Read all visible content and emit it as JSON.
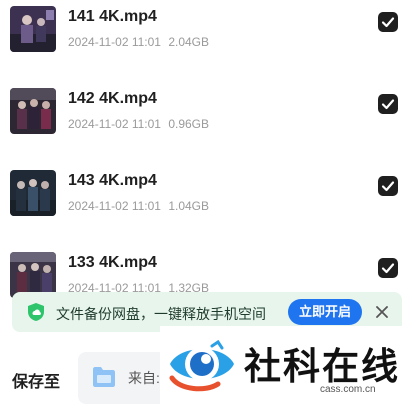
{
  "files": [
    {
      "name": "141 4K.mp4",
      "date": "2024-11-02 11:01",
      "size": "2.04GB",
      "checked": true
    },
    {
      "name": "142 4K.mp4",
      "date": "2024-11-02 11:01",
      "size": "0.96GB",
      "checked": true
    },
    {
      "name": "143 4K.mp4",
      "date": "2024-11-02 11:01",
      "size": "1.04GB",
      "checked": true
    },
    {
      "name": "133 4K.mp4",
      "date": "2024-11-02 11:01",
      "size": "1.32GB",
      "checked": true
    }
  ],
  "banner": {
    "text": "文件备份网盘，一键释放手机空间",
    "button_label": "立即开启",
    "icon": "cloud-shield-icon",
    "close_icon": "close-icon"
  },
  "save": {
    "label": "保存至",
    "destination": "来自:"
  },
  "watermark": {
    "name": "社科在线",
    "domain": "cass.com.cn"
  },
  "colors": {
    "accent": "#1f74f0",
    "banner_bg": "#e7f5ec",
    "banner_icon": "#2ec46b",
    "check_bg": "#1f1f1f"
  }
}
